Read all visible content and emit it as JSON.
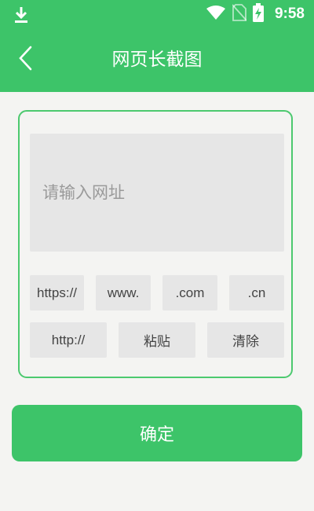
{
  "status_bar": {
    "time": "9:58",
    "icons": [
      "download-icon",
      "wifi-icon",
      "no-sim-icon",
      "battery-charging-icon"
    ]
  },
  "toolbar": {
    "title": "网页长截图",
    "back_icon": "chevron-left-icon"
  },
  "form": {
    "url_placeholder": "请输入网址",
    "url_value": "",
    "quick_row1": [
      "https://",
      "www.",
      ".com",
      ".cn"
    ],
    "quick_row2": [
      "http://",
      "粘贴",
      "清除"
    ]
  },
  "confirm_label": "确定",
  "colors": {
    "accent": "#3dc469",
    "card_border": "#4cc96f",
    "input_bg": "#e6e6e6",
    "background": "#f4f4f2"
  }
}
